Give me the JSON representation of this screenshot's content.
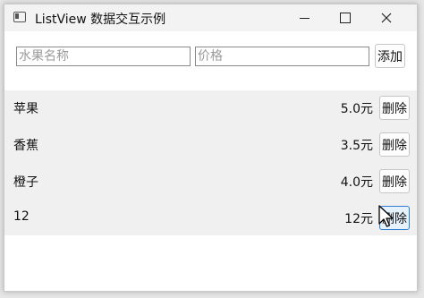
{
  "window": {
    "title": "ListView 数据交互示例",
    "controls": {
      "minimize": "—",
      "maximize": "□",
      "close": "✕"
    }
  },
  "form": {
    "name_placeholder": "水果名称",
    "price_placeholder": "价格",
    "add_label": "添加"
  },
  "items": [
    {
      "name": "苹果",
      "price": "5.0元",
      "delete_label": "删除"
    },
    {
      "name": "香蕉",
      "price": "3.5元",
      "delete_label": "删除"
    },
    {
      "name": "橙子",
      "price": "4.0元",
      "delete_label": "删除"
    },
    {
      "name": "12",
      "price": "12元",
      "delete_label": "删除"
    }
  ],
  "icons": {
    "app": "window-icon",
    "cursor": "mouse-pointer-icon"
  }
}
